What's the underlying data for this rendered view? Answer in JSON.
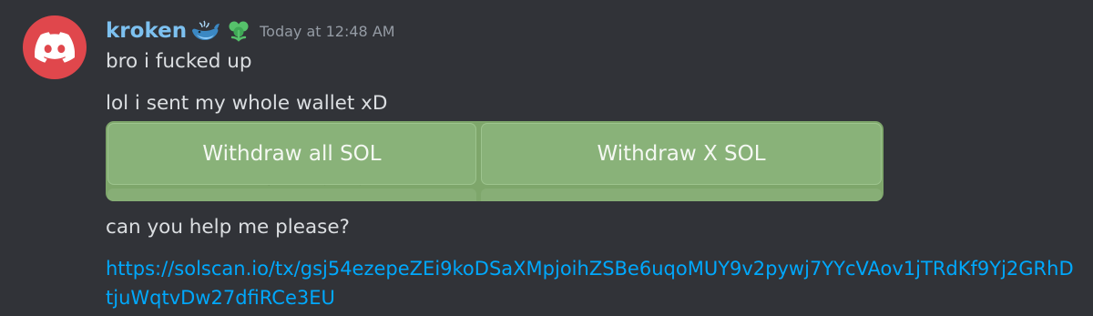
{
  "message": {
    "avatar_icon": "discord-logo-icon",
    "avatar_color": "#e0474c",
    "username": "kroken",
    "username_color": "#7dc1f0",
    "badges": [
      "whale-emoji-icon",
      "clover-role-icon"
    ],
    "timestamp": "Today at 12:48 AM",
    "lines": [
      "bro i fucked up",
      "lol i sent my whole wallet xD",
      "can you help me please?"
    ],
    "attachment": {
      "background_color": "#7ea66b",
      "buttons": [
        "Withdraw all SOL",
        "Withdraw X SOL"
      ]
    },
    "link": "https://solscan.io/tx/gsj54ezepeZEi9koDSaXMpjoihZSBe6uqoMUY9v2pywj7YYcVAov1jTRdKf9Yj2GRhDtjuWqtvDw27dfiRCe3EU",
    "link_color": "#00a8fc"
  }
}
